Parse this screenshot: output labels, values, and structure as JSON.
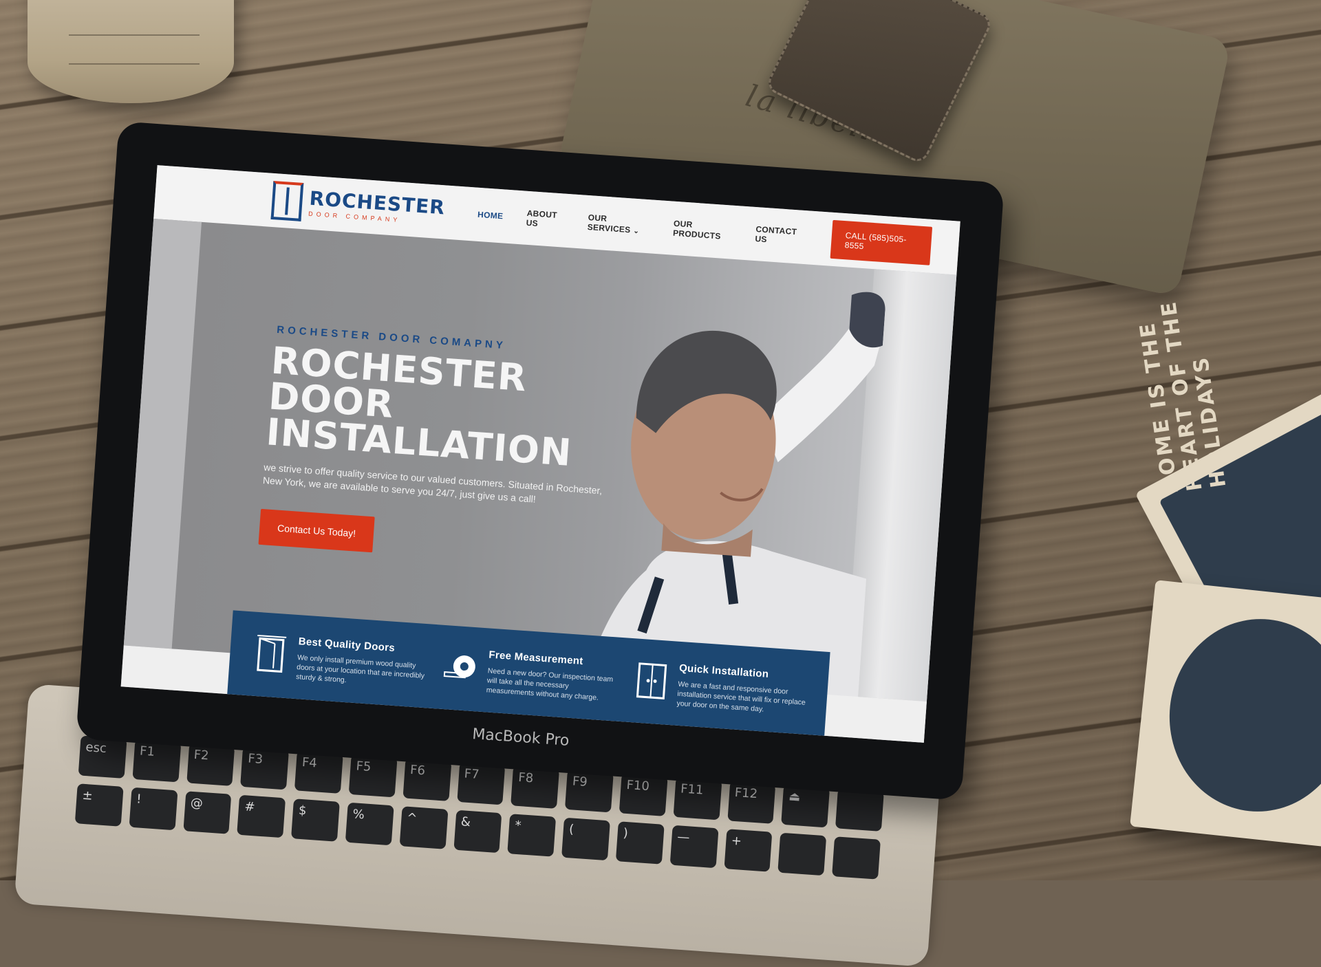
{
  "scene": {
    "pouch_text": "la libellule",
    "coaster_text": "HOME IS THE HEART OF THE HOLIDAYS",
    "laptop_brand": "MacBook Pro"
  },
  "site": {
    "logo": {
      "name": "ROCHESTER",
      "sub": "DOOR COMPANY"
    },
    "nav": {
      "home": "HOME",
      "about": "ABOUT US",
      "services": "OUR SERVICES",
      "products": "OUR PRODUCTS",
      "contact": "CONTACT US"
    },
    "call_button": "CALL (585)505-8555",
    "hero": {
      "overline": "ROCHESTER DOOR COMAPNY",
      "title": "ROCHESTER DOOR INSTALLATION",
      "text": "we strive to offer quality service to our valued customers. Situated in Rochester, New York, we are available to serve you 24/7, just give us a call!",
      "button": "Contact Us Today!"
    },
    "features": [
      {
        "title": "Best Quality Doors",
        "text": "We only install premium wood quality doors at your location that are incredibly sturdy & strong.",
        "icon": "door-icon"
      },
      {
        "title": "Free Measurement",
        "text": "Need a new door? Our inspection team will take all the necessary measurements without any charge.",
        "icon": "tape-measure-icon"
      },
      {
        "title": "Quick Installation",
        "text": "We are a fast and responsive door installation service that will fix or replace your door on the same day.",
        "icon": "double-door-icon"
      }
    ],
    "colors": {
      "brand_blue": "#1b4a86",
      "accent_red": "#d9371a",
      "feature_band": "#1c4772"
    }
  },
  "keyboard": {
    "row1": [
      "esc",
      "F1",
      "F2",
      "F3",
      "F4",
      "F5",
      "F6",
      "F7",
      "F8",
      "F9",
      "F10",
      "F11",
      "F12",
      "⏏",
      ""
    ],
    "row2": [
      "±",
      "!",
      "@",
      "#",
      "$",
      "%",
      "^",
      "&",
      "*",
      "(",
      ")",
      "—",
      "+",
      "",
      ""
    ]
  }
}
